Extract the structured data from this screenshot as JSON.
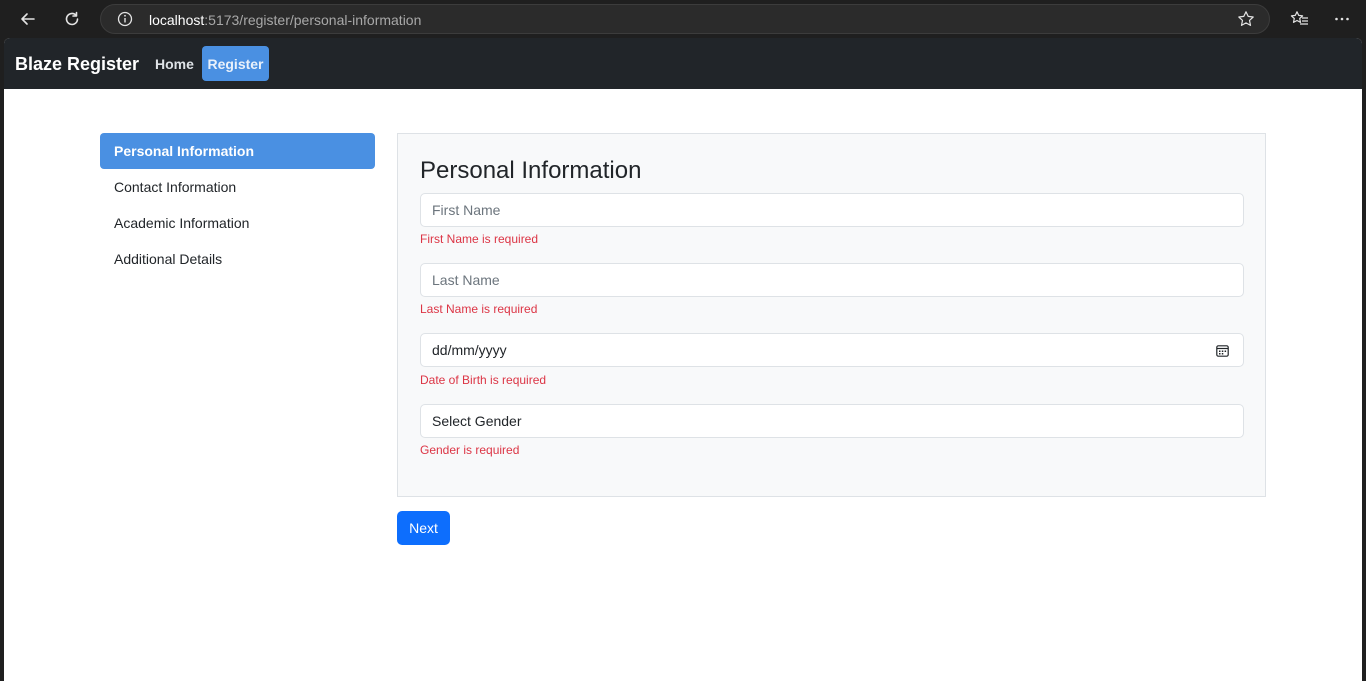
{
  "browser": {
    "url_host": "localhost",
    "url_rest": ":5173/register/personal-information"
  },
  "navbar": {
    "brand": "Blaze Register",
    "links": [
      {
        "label": "Home",
        "active": false
      },
      {
        "label": "Register",
        "active": true
      }
    ]
  },
  "sidebar": {
    "items": [
      {
        "label": "Personal Information",
        "active": true
      },
      {
        "label": "Contact Information",
        "active": false
      },
      {
        "label": "Academic Information",
        "active": false
      },
      {
        "label": "Additional Details",
        "active": false
      }
    ]
  },
  "form": {
    "title": "Personal Information",
    "first_name": {
      "value": "",
      "placeholder": "First Name",
      "error": "First Name is required"
    },
    "last_name": {
      "value": "",
      "placeholder": "Last Name",
      "error": "Last Name is required"
    },
    "dob": {
      "display": "dd/mm/yyyy",
      "error": "Date of Birth is required"
    },
    "gender": {
      "selected": "Select Gender",
      "error": "Gender is required"
    },
    "next_label": "Next"
  },
  "colors": {
    "navbar_bg": "#212529",
    "accent": "#4a90e2",
    "primary_button": "#0d6efd",
    "error_text": "#dc3545"
  },
  "icons": [
    "back-icon",
    "reload-icon",
    "info-icon",
    "star-icon",
    "favorites-icon",
    "more-icon",
    "calendar-icon"
  ]
}
